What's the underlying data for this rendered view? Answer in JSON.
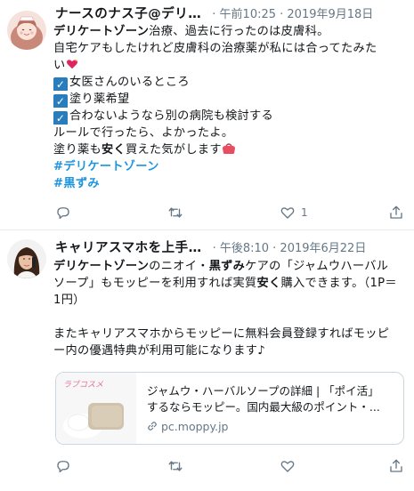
{
  "tweet1": {
    "name": "ナースのナス子@デリ…",
    "time": "· 午前10:25 · 2019年9月18日",
    "line1_bold": "デリケートゾーン",
    "line1_rest": "治療、過去に行ったのは皮膚科。",
    "line2": "自宅ケアもしたけれど皮膚科の治療薬が私には合ってたみた",
    "line3": "い",
    "check1": "女医さんのいるところ",
    "check2": "塗り薬希望",
    "check3": "合わないようなら別の病院も検討する",
    "line7": "ルールで行ったら、よかったよ。",
    "line8_a": "塗り薬も",
    "line8_bold": "安く",
    "line8_b": "買えた気がします",
    "hashtag1": "#デリケートゾーン",
    "hashtag2": "#黒ずみ",
    "like_count": "1",
    "heart_color": "#e0245e"
  },
  "tweet2": {
    "name": "キャリアスマホを上手…",
    "time": "· 午後8:10 · 2019年6月22日",
    "p1_bold1": "デリケートゾーン",
    "p1_a": "のニオイ・",
    "p1_bold2": "黒ずみ",
    "p1_b": "ケアの「ジャムウハーバル",
    "p1_c": "ソープ」もモッピーを利用すれば実質",
    "p1_bold3": "安く",
    "p1_d": "購入できます。（1P＝",
    "p1_e": "1円）",
    "p2_a": "またキャリアスマホからモッピーに無料会員登録すればモッピ",
    "p2_b": "ー内の優遇特典が利用可能になります♪",
    "card_title1": "ジャムウ・ハーバルソープの詳細 | 「ポイ活」",
    "card_title2": "するならモッピー。国内最大級のポイント・...",
    "card_url": "pc.moppy.jp",
    "card_thumb_text": "ラブコスメ"
  },
  "accent_color": "#1b95e0",
  "icon_color": "#657786"
}
